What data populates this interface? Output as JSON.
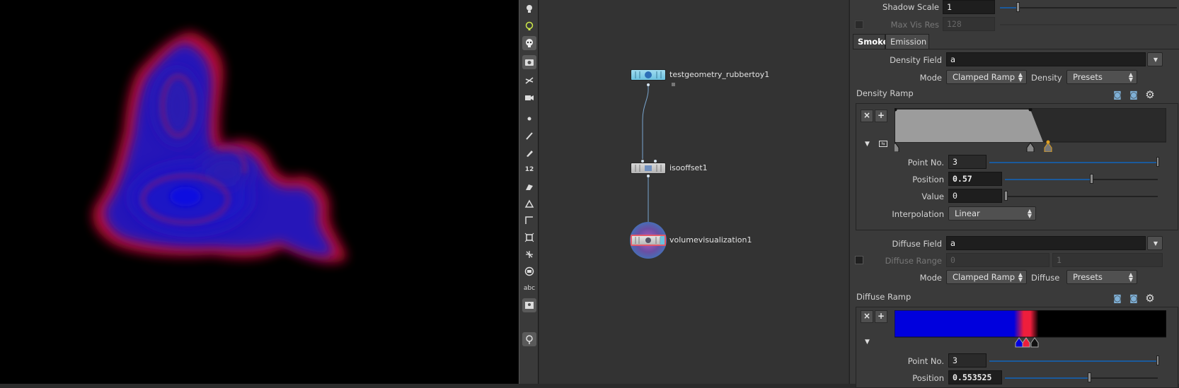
{
  "network": {
    "nodes": [
      {
        "label": "testgeometry_rubbertoy1"
      },
      {
        "label": "isooffset1"
      },
      {
        "label": "volumevisualization1"
      }
    ]
  },
  "toolbar": {
    "items": [
      "bulb-icon",
      "light-icon",
      "skull-icon",
      "camera-icon",
      "pose-icon",
      "render-icon",
      "dot-icon",
      "brush-icon",
      "pen-icon",
      "number-icon",
      "paint-icon",
      "measure-icon",
      "angle-icon",
      "snap-icon",
      "compass-icon",
      "circle-icon",
      "text-icon",
      "image-icon",
      "pin-icon"
    ],
    "number_label": "12",
    "text_label": "abc"
  },
  "params": {
    "shadow_scale": {
      "label": "Shadow Scale",
      "value": "1"
    },
    "max_vis_res": {
      "label": "Max Vis Res",
      "value": "128"
    },
    "tabs": [
      {
        "label": "Smoke",
        "active": true
      },
      {
        "label": "Emission",
        "active": false
      }
    ],
    "density_field": {
      "label": "Density Field",
      "value": "a"
    },
    "density_mode": {
      "label": "Mode",
      "value": "Clamped Ramp",
      "preset_label": "Density",
      "preset_value": "Presets"
    },
    "density_ramp": {
      "label": "Density Ramp",
      "point_no": {
        "label": "Point No.",
        "value": "3"
      },
      "position": {
        "label": "Position",
        "value": "0.57"
      },
      "value": {
        "label": "Value",
        "value": "0"
      },
      "interpolation": {
        "label": "Interpolation",
        "value": "Linear"
      }
    },
    "diffuse_field": {
      "label": "Diffuse Field",
      "value": "a"
    },
    "diffuse_range": {
      "label": "Diffuse Range",
      "min": "0",
      "max": "1"
    },
    "diffuse_mode": {
      "label": "Mode",
      "value": "Clamped Ramp",
      "preset_label": "Diffuse",
      "preset_value": "Presets"
    },
    "diffuse_ramp": {
      "label": "Diffuse Ramp",
      "point_no": {
        "label": "Point No.",
        "value": "3"
      },
      "position": {
        "label": "Position",
        "value": "0.553525"
      }
    },
    "ramp_buttons": {
      "remove": "×",
      "add": "+"
    }
  },
  "colors": {
    "accent": "#1b5a9c",
    "ramp_blue": "#0000dd",
    "ramp_red": "#ee1e3c",
    "node_teal": "#7fd0ea",
    "node_selected": "#e35a6a"
  }
}
